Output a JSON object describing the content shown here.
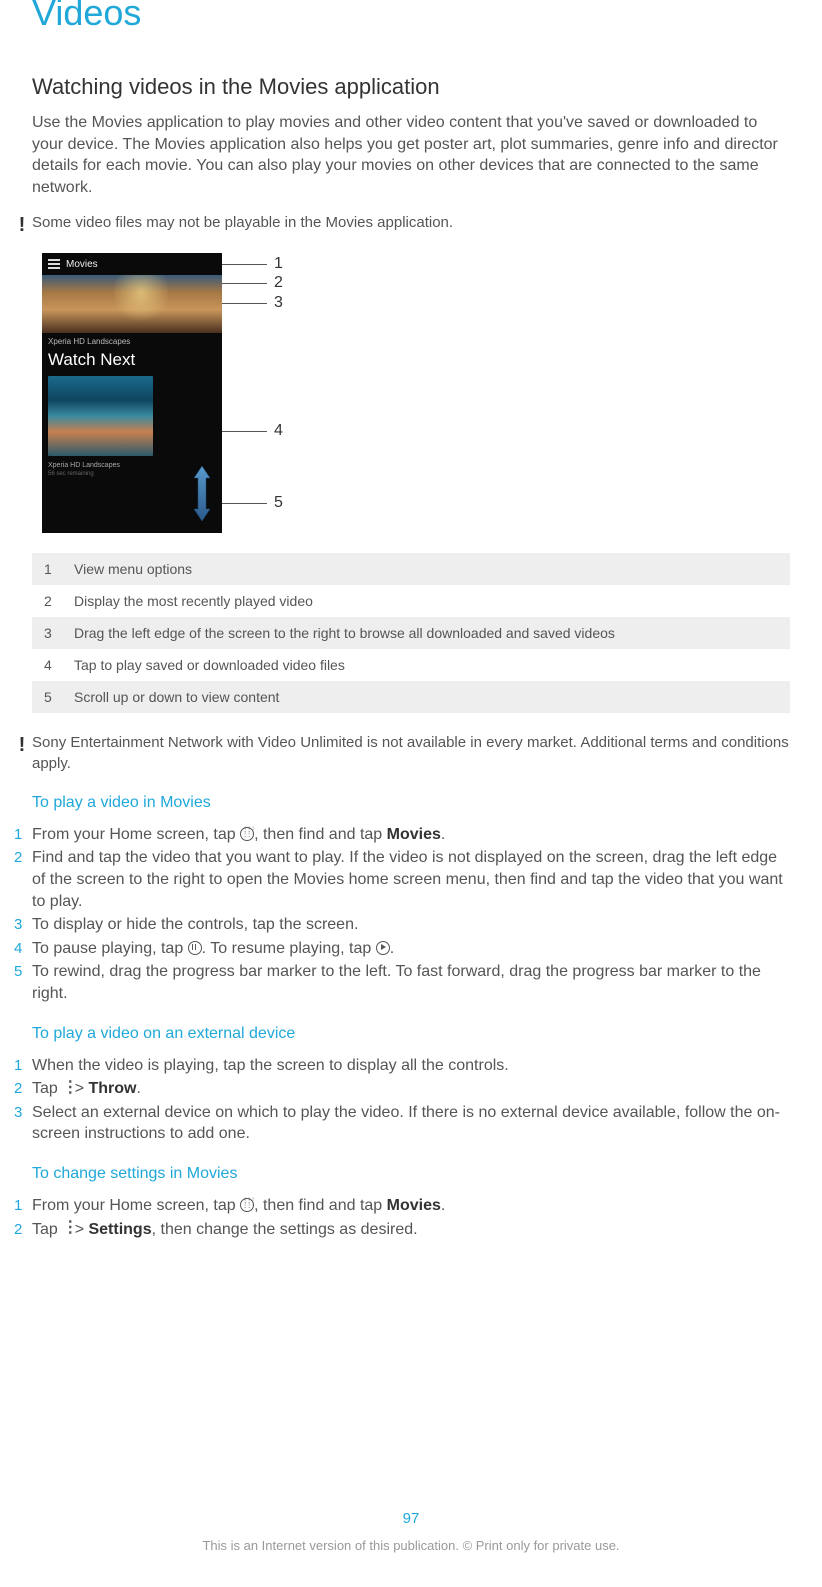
{
  "page_title": "Videos",
  "section_heading": "Watching videos in the Movies application",
  "intro": "Use the Movies application to play movies and other video content that you've saved or downloaded to your device. The Movies application also helps you get poster art, plot summaries, genre info and director details for each movie. You can also play your movies on other devices that are connected to the same network.",
  "note1": "Some video files may not be playable in the Movies application.",
  "figure": {
    "header_title": "Movies",
    "category1": "Xperia HD Landscapes",
    "watch_next": "Watch Next",
    "thumb_label": "Xperia HD Landscapes",
    "thumb_sub": "56 sec remaining",
    "callouts": [
      "1",
      "2",
      "3",
      "4",
      "5"
    ]
  },
  "legend": [
    {
      "n": "1",
      "t": "View menu options"
    },
    {
      "n": "2",
      "t": "Display the most recently played video"
    },
    {
      "n": "3",
      "t": "Drag the left edge of the screen to the right to browse all downloaded and saved videos"
    },
    {
      "n": "4",
      "t": "Tap to play saved or downloaded video files"
    },
    {
      "n": "5",
      "t": "Scroll up or down to view content"
    }
  ],
  "note2": "Sony Entertainment Network with Video Unlimited is not available in every market. Additional terms and conditions apply.",
  "sub1": "To play a video in Movies",
  "steps1": {
    "s1a": "From your Home screen, tap ",
    "s1b": ", then find and tap ",
    "s1c": "Movies",
    "s1d": ".",
    "s2": "Find and tap the video that you want to play. If the video is not displayed on the screen, drag the left edge of the screen to the right to open the Movies home screen menu, then find and tap the video that you want to play.",
    "s3": "To display or hide the controls, tap the screen.",
    "s4a": "To pause playing, tap ",
    "s4b": ". To resume playing, tap ",
    "s4c": ".",
    "s5": "To rewind, drag the progress bar marker to the left. To fast forward, drag the progress bar marker to the right."
  },
  "sub2": "To play a video on an external device",
  "steps2": {
    "s1": "When the video is playing, tap the screen to display all the controls.",
    "s2a": "Tap ",
    "s2b": " > ",
    "s2c": "Throw",
    "s2d": ".",
    "s3": "Select an external device on which to play the video. If there is no external device available, follow the on-screen instructions to add one."
  },
  "sub3": "To change settings in Movies",
  "steps3": {
    "s1a": "From your Home screen, tap ",
    "s1b": ", then find and tap ",
    "s1c": "Movies",
    "s1d": ".",
    "s2a": "Tap ",
    "s2b": " > ",
    "s2c": "Settings",
    "s2d": ", then change the settings as desired."
  },
  "page_number": "97",
  "footer": "This is an Internet version of this publication. © Print only for private use."
}
